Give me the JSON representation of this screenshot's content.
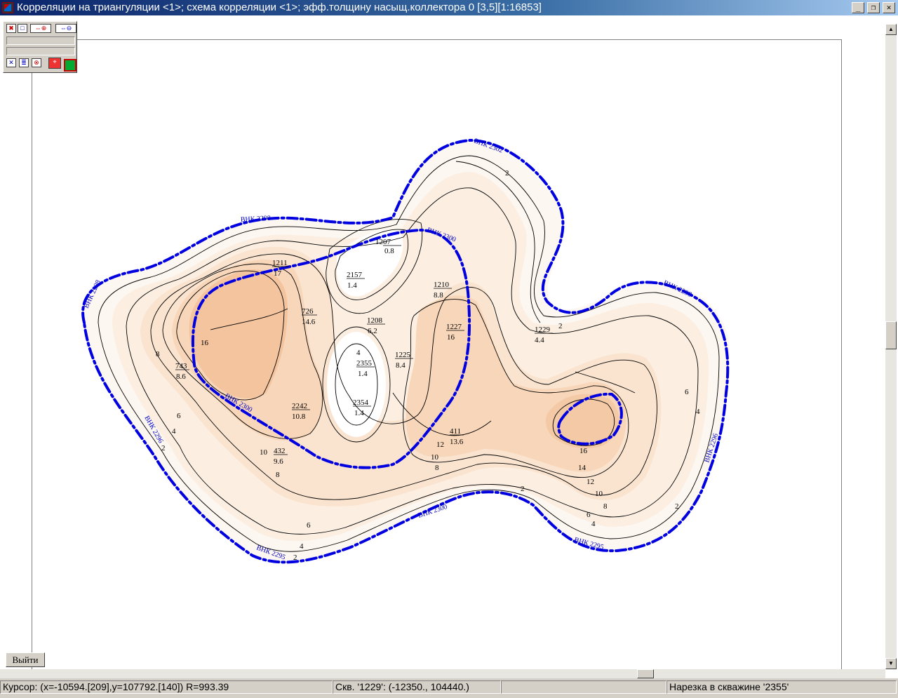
{
  "window": {
    "title": "Корреляции на триангуляции <1>; схема корреляции <1>; эфф.толщину насыщ.коллектора 0 [3,5][1:16853]",
    "controls": [
      "_",
      "❐",
      "✕"
    ]
  },
  "buttons": {
    "exit_label": "Выйти"
  },
  "status": {
    "cursor": "Курсор: (x=-10594.[209],y=107792.[140]) R=993.39",
    "well": "Скв. '1229': (-12350., 104440.)",
    "empty": "",
    "cut": "Нарезка в скважине '2355'"
  },
  "map": {
    "fill_colors": [
      "#fdf6f0",
      "#fbe9da",
      "#f9dcc4",
      "#f7cfac",
      "#f3bf93"
    ],
    "boundary_color": "#0000e0",
    "boundary_labels": [
      "ВНК 2298",
      "ВНК 2296",
      "ВНК 2295",
      "ВНК 2300",
      "ВНК 2302"
    ],
    "wells": [
      {
        "name": "1207",
        "value": "0.8"
      },
      {
        "name": "1211",
        "value": "17"
      },
      {
        "name": "2157",
        "value": "1.4"
      },
      {
        "name": "726",
        "value": "14.6"
      },
      {
        "name": "1210",
        "value": "8.8"
      },
      {
        "name": "1208",
        "value": "6.2"
      },
      {
        "name": "1227",
        "value": "16"
      },
      {
        "name": "1229",
        "value": "4.4"
      },
      {
        "name": "2355",
        "value": "1.4"
      },
      {
        "name": "1225",
        "value": "8.4"
      },
      {
        "name": "743",
        "value": "8.6"
      },
      {
        "name": "2242",
        "value": "10.8"
      },
      {
        "name": "2354",
        "value": "1.4"
      },
      {
        "name": "411",
        "value": "13.6"
      },
      {
        "name": "432",
        "value": "9.6"
      }
    ],
    "isoline_labels": [
      "2",
      "4",
      "6",
      "8",
      "10",
      "12",
      "14",
      "16"
    ]
  }
}
